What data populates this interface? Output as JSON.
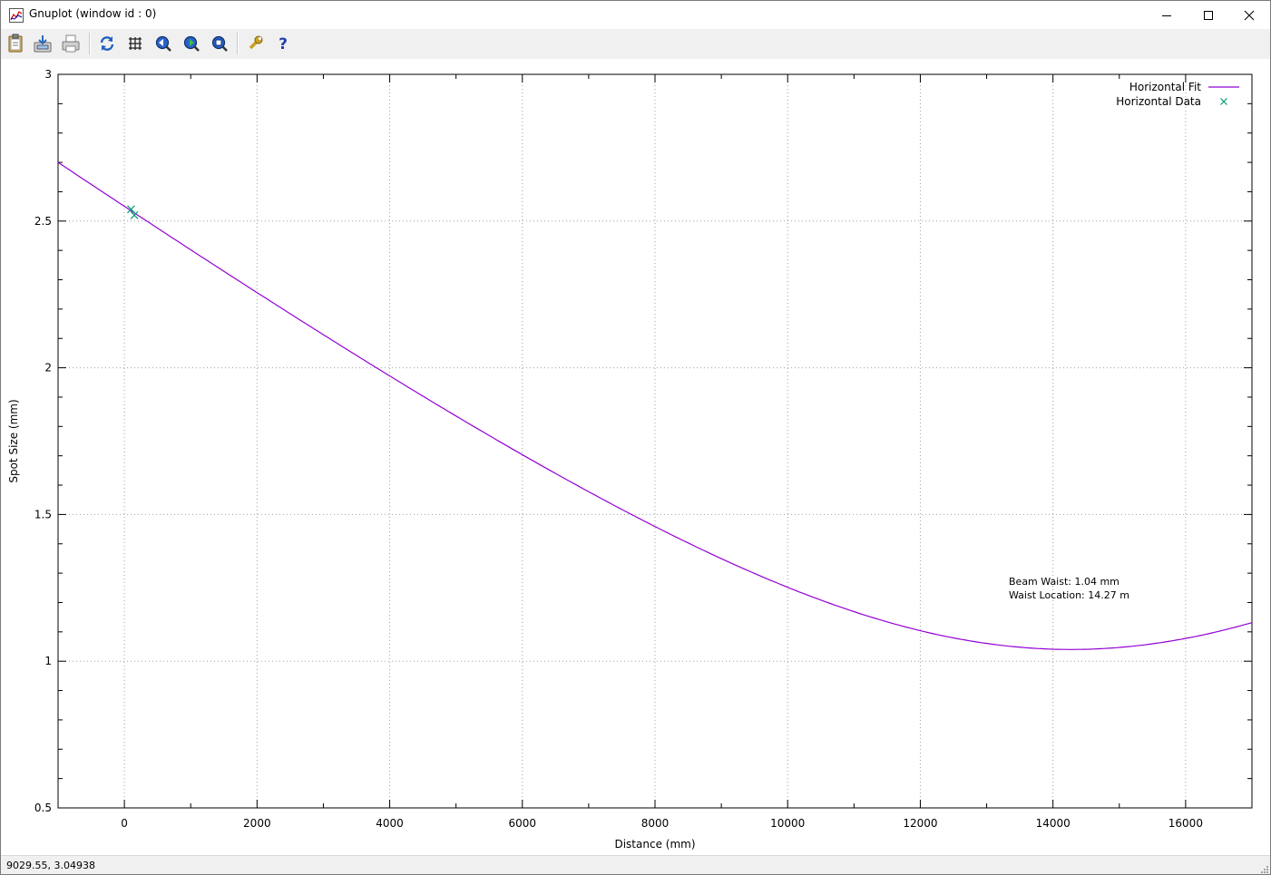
{
  "window": {
    "title": "Gnuplot (window id : 0)"
  },
  "toolbar": {
    "buttons": [
      {
        "name": "copy-clipboard-button",
        "icon": "clipboard-icon"
      },
      {
        "name": "save-button",
        "icon": "save-icon"
      },
      {
        "name": "print-button",
        "icon": "printer-icon"
      },
      {
        "name": "replot-button",
        "icon": "refresh-icon"
      },
      {
        "name": "grid-button",
        "icon": "grid-icon"
      },
      {
        "name": "previous-zoom-button",
        "icon": "zoom-back-icon"
      },
      {
        "name": "next-zoom-button",
        "icon": "zoom-forward-icon"
      },
      {
        "name": "autoscale-button",
        "icon": "zoom-fit-icon"
      },
      {
        "name": "options-button",
        "icon": "wrench-icon"
      },
      {
        "name": "help-button",
        "icon": "help-icon"
      }
    ]
  },
  "chart_data": {
    "type": "line",
    "xlabel": "Distance (mm)",
    "ylabel": "Spot Size (mm)",
    "xlim": [
      -1000,
      17000
    ],
    "ylim": [
      0.5,
      3
    ],
    "xticks": [
      0,
      2000,
      4000,
      6000,
      8000,
      10000,
      12000,
      14000,
      16000
    ],
    "yticks": [
      0.5,
      1,
      1.5,
      2,
      2.5,
      3
    ],
    "grid": true,
    "legend_position": "top-right",
    "series": [
      {
        "name": "Horizontal Fit",
        "type": "line",
        "color": "#9400d3",
        "waist_mm": 1.04,
        "waist_location_mm": 14270,
        "x": [
          -1000,
          0,
          1000,
          2000,
          3000,
          4000,
          5000,
          6000,
          7000,
          8000,
          9000,
          10000,
          11000,
          12000,
          13000,
          14000,
          14270,
          15000,
          16000,
          17000
        ],
        "y": [
          2.7,
          2.54,
          2.38,
          2.25,
          2.12,
          1.98,
          1.84,
          1.71,
          1.58,
          1.46,
          1.35,
          1.25,
          1.17,
          1.1,
          1.06,
          1.04,
          1.04,
          1.05,
          1.08,
          1.13
        ]
      },
      {
        "name": "Horizontal Data",
        "type": "scatter",
        "color": "#009e73",
        "marker": "x",
        "x": [
          100,
          150
        ],
        "y": [
          2.54,
          2.52
        ]
      }
    ],
    "annotations": [
      "Beam Waist: 1.04 mm",
      "Waist Location: 14.27 m"
    ]
  },
  "statusbar": {
    "coordinates": "9029.55,  3.04938"
  }
}
